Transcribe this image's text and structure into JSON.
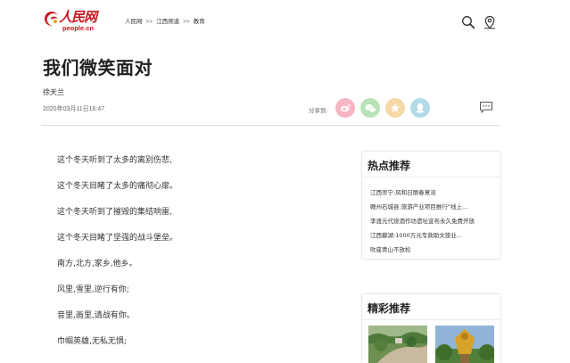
{
  "header": {
    "logo_cn": "人民网",
    "logo_en": "people.cn",
    "breadcrumb": [
      "人民网",
      "江西频道",
      "教育"
    ],
    "breadcrumb_sep": ">>",
    "search_icon": "search-icon",
    "location_icon": "location-pin-icon"
  },
  "article": {
    "title": "我们微笑面对",
    "author": "徐天兰",
    "date": "2020年03月11日16:47",
    "share_label": "分享到:",
    "share_icons": [
      "weibo-icon",
      "wechat-icon",
      "qzone-icon",
      "qq-icon"
    ],
    "comment_icon": "comment-icon",
    "lines": [
      "这个冬天听到了太多的离别伤悲,",
      "这个冬天目睹了太多的痛彻心扉。",
      "这个冬天听到了摧毁的集结响雷,",
      "这个冬天目睹了坚强的战斗堡垒。",
      "南方,北方,家乡,他乡。",
      "风里,雪里,逆行有你;",
      "音里,画里,请战有你。",
      "巾帼英雄,无私无惧;"
    ]
  },
  "sidebar": {
    "hot_title": "热点推荐",
    "hot_items": [
      "江西崇宁:风和日丽春意浓",
      "赣州石城县:旅游产业项目推行“线上...",
      "李渡元代烧酒作坊遗址宣布永久免费开放",
      "江西鄱湖:1000万元专款助文旅业...",
      "吹座青山不放松"
    ],
    "featured_title": "精彩推荐"
  },
  "colors": {
    "brand_red": "#c8161d",
    "weibo": "#f6b6c1",
    "wechat": "#b9e2b6",
    "qzone": "#f6d9a6",
    "qq": "#b1dbe8"
  }
}
